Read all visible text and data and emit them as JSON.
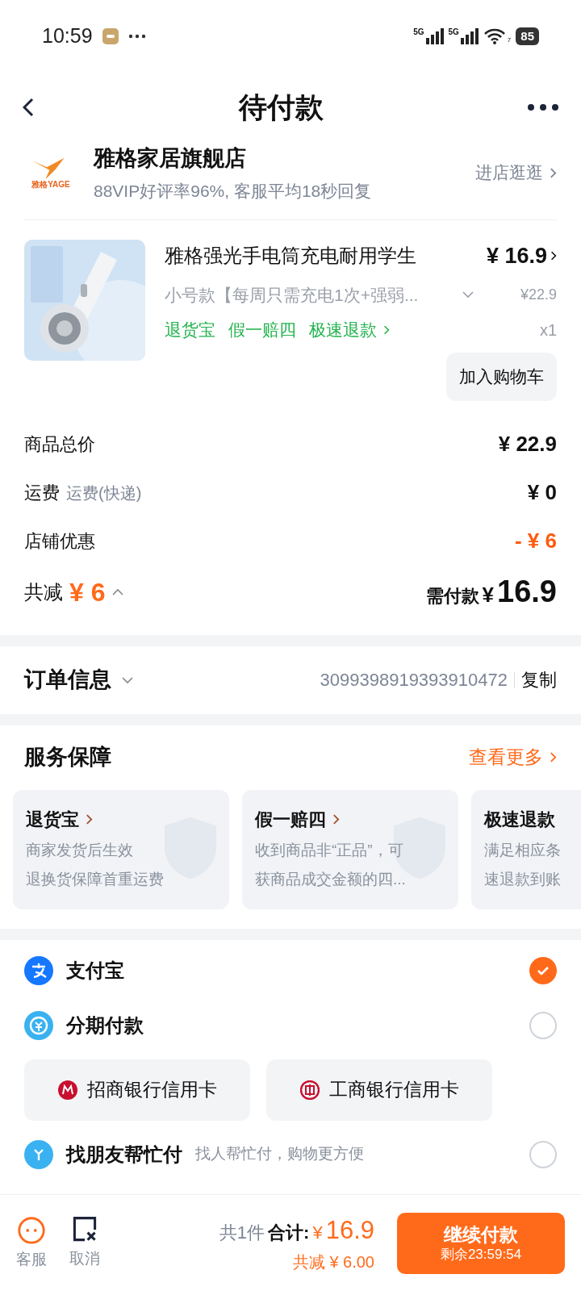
{
  "status_bar": {
    "time": "10:59",
    "network_1": "5G",
    "network_2": "5G",
    "wifi_badge": "7",
    "battery": "85"
  },
  "header": {
    "title": "待付款"
  },
  "store": {
    "logo_text": "雅格YAGE",
    "name": "雅格家居旗舰店",
    "subtitle": "88VIP好评率96%, 客服平均18秒回复",
    "visit": "进店逛逛"
  },
  "product": {
    "title": "雅格强光手电筒充电耐用学生",
    "price": "¥ 16.9",
    "variant": "小号款【每周只需充电1次+强弱...",
    "original_price": "¥22.9",
    "services": [
      "退货宝",
      "假一赔四",
      "极速退款"
    ],
    "quantity": "x1",
    "cart_button": "加入购物车"
  },
  "summary": [
    {
      "label": "商品总价",
      "value": "¥ 22.9",
      "kind": "normal"
    },
    {
      "label": "运费",
      "note": "运费(快递)",
      "value": "¥ 0",
      "kind": "normal"
    },
    {
      "label": "店铺优惠",
      "value": "- ¥ 6",
      "kind": "discount"
    }
  ],
  "totals": {
    "saved_label": "共减",
    "saved_value": "¥ 6",
    "due_label": "需付款",
    "due_currency": "¥",
    "due_value": "16.9"
  },
  "order_info": {
    "title": "订单信息",
    "number": "3099398919393910472",
    "copy": "复制"
  },
  "services": {
    "title": "服务保障",
    "more": "查看更多",
    "cards": [
      {
        "title": "退货宝",
        "lines": [
          "商家发货后生效",
          "退换货保障首重运费"
        ]
      },
      {
        "title": "假一赔四",
        "lines": [
          "收到商品非“正品”，可",
          "获商品成交金额的四..."
        ]
      },
      {
        "title": "极速退款",
        "lines": [
          "满足相应条",
          "速退款到账"
        ]
      }
    ]
  },
  "payment": [
    {
      "name": "支付宝",
      "kind": "alipay",
      "selected": true
    },
    {
      "name": "分期付款",
      "kind": "installment",
      "selected": false,
      "banks": [
        {
          "name": "招商银行信用卡",
          "kind": "cmb"
        },
        {
          "name": "工商银行信用卡",
          "kind": "icbc"
        }
      ]
    },
    {
      "name": "找朋友帮忙付",
      "note": "找人帮忙付，购物更方便",
      "kind": "friend",
      "selected": false
    }
  ],
  "bottom_bar": {
    "service": "客服",
    "cancel": "取消",
    "count": "共1件",
    "total_label": "合计:",
    "total_currency": "¥",
    "total_value": "16.9",
    "saved": "共减 ¥ 6.00",
    "pay_button": "继续付款",
    "countdown": "剩余23:59:54"
  }
}
